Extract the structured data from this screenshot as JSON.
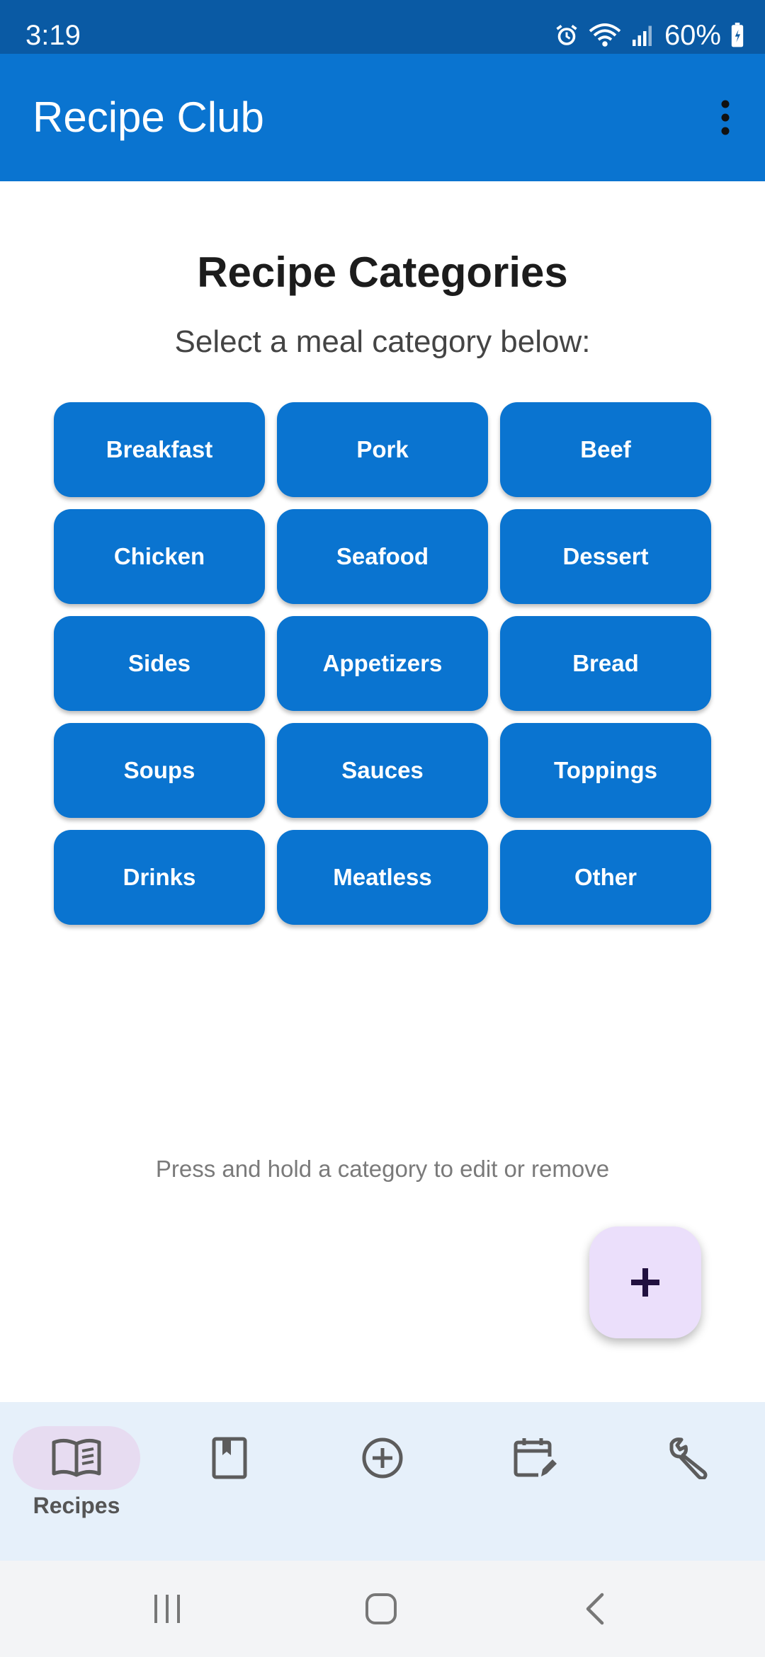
{
  "status_bar": {
    "time": "3:19",
    "battery_percent": "60%",
    "icons": [
      "alarm-icon",
      "wifi-icon",
      "signal-icon",
      "battery-icon"
    ]
  },
  "app_bar": {
    "title": "Recipe Club",
    "menu_icon": "more-vertical-icon"
  },
  "main": {
    "title": "Recipe Categories",
    "subtitle": "Select a meal category below:",
    "categories": [
      "Breakfast",
      "Pork",
      "Beef",
      "Chicken",
      "Seafood",
      "Dessert",
      "Sides",
      "Appetizers",
      "Bread",
      "Soups",
      "Sauces",
      "Toppings",
      "Drinks",
      "Meatless",
      "Other"
    ],
    "hint": "Press and hold a category to edit or remove"
  },
  "fab": {
    "icon": "plus-icon"
  },
  "bottom_nav": {
    "items": [
      {
        "label": "Recipes",
        "icon": "open-book-icon",
        "selected": true
      },
      {
        "label": "",
        "icon": "bookmark-book-icon",
        "selected": false
      },
      {
        "label": "",
        "icon": "add-circle-icon",
        "selected": false
      },
      {
        "label": "",
        "icon": "calendar-edit-icon",
        "selected": false
      },
      {
        "label": "",
        "icon": "wrench-icon",
        "selected": false
      }
    ]
  },
  "system_nav": {
    "buttons": [
      "recents-icon",
      "home-icon",
      "back-icon"
    ]
  },
  "colors": {
    "status_bar": "#0a5aa4",
    "primary": "#0a74d0",
    "fab_background": "#ebdffb",
    "nav_background": "#e6f0fa",
    "nav_indicator": "#e7dcf1"
  }
}
